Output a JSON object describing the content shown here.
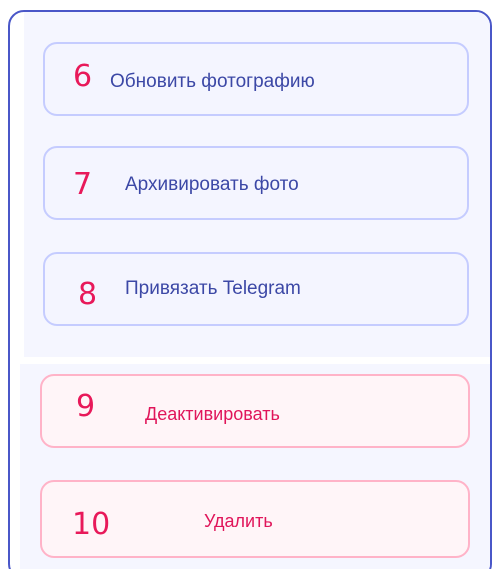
{
  "colors": {
    "panel_border": "#4a57c8",
    "primary_button_border": "#c5ccff",
    "primary_button_text": "#3c48a6",
    "danger_button_border": "#ffb3c8",
    "danger_button_text": "#e0155a",
    "step_number": "#e8195a"
  },
  "actions": [
    {
      "step": "6",
      "label": "Обновить фотографию"
    },
    {
      "step": "7",
      "label": "Архивировать фото"
    },
    {
      "step": "8",
      "label": "Привязать Telegram"
    },
    {
      "step": "9",
      "label": "Деактивировать"
    },
    {
      "step": "10",
      "label": "Удалить"
    }
  ]
}
